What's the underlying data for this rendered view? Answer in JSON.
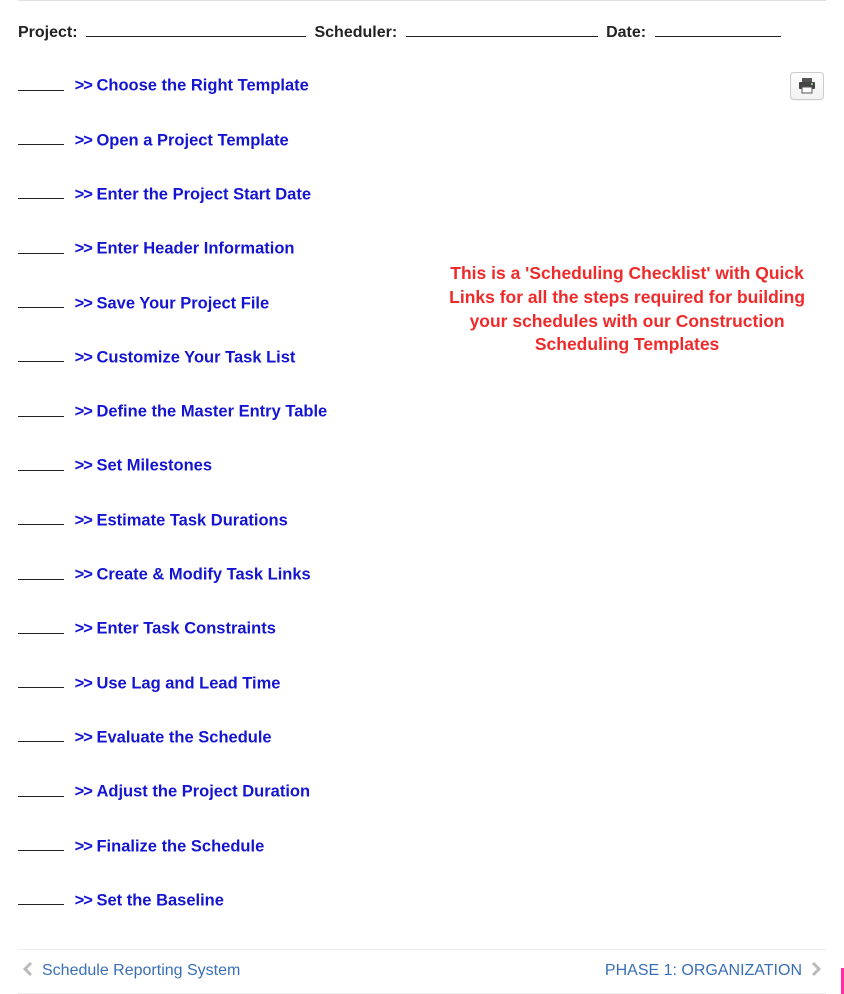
{
  "form": {
    "project_label": "Project:",
    "scheduler_label": "Scheduler:",
    "date_label": "Date:"
  },
  "checklist": {
    "chevron": ">>",
    "items": [
      {
        "label": "Choose the Right Template"
      },
      {
        "label": "Open a Project Template"
      },
      {
        "label": "Enter the Project Start Date"
      },
      {
        "label": "Enter Header Information"
      },
      {
        "label": "Save Your Project File"
      },
      {
        "label": "Customize Your Task List"
      },
      {
        "label": "Define the Master Entry Table"
      },
      {
        "label": "Set Milestones"
      },
      {
        "label": "Estimate Task Durations"
      },
      {
        "label": "Create & Modify Task Links"
      },
      {
        "label": "Enter Task Constraints"
      },
      {
        "label": "Use Lag and Lead Time"
      },
      {
        "label": "Evaluate the Schedule"
      },
      {
        "label": "Adjust the Project Duration"
      },
      {
        "label": "Finalize the Schedule"
      },
      {
        "label": "Set the Baseline"
      }
    ]
  },
  "callout": {
    "text": "This is a 'Scheduling Checklist' with Quick Links for all the steps required for building your schedules with our Construction Scheduling Templates"
  },
  "pager": {
    "prev": "Schedule Reporting System",
    "next": "PHASE 1: ORGANIZATION"
  },
  "icons": {
    "print": "print-icon"
  }
}
